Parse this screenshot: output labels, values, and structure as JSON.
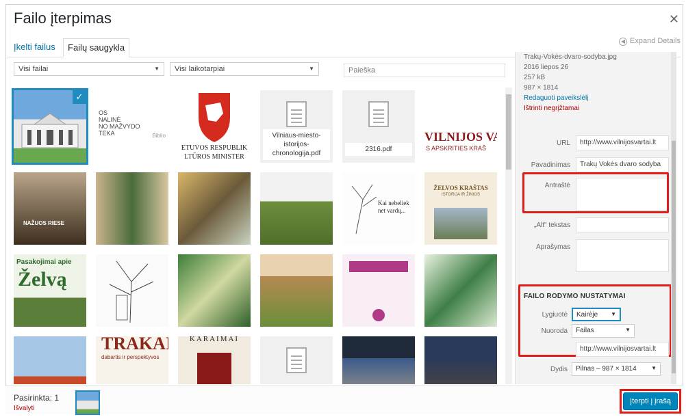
{
  "title": "Failo įterpimas",
  "tabs": {
    "upload": "Įkelti failus",
    "library": "Failų saugykla"
  },
  "expand_label": "Expand Details",
  "filters": {
    "type": "Visi failai",
    "date": "Visi laikotarpiai",
    "search_placeholder": "Paieška"
  },
  "grid": {
    "pdf1": "Vilniaus-miesto-istorijos-chronologija.pdf",
    "pdf2": "2316.pdf",
    "t_lib": "OS\nNALINĖ\nNO MAŽVYDO\nTEKA",
    "t_lib2": "Biblio",
    "t_culture": "ETUVOS RESPUBLIK\nLTŪROS MINISTER",
    "t_vilnijos": "VILNIJOS VA",
    "t_vilnijos2": "S APSKRITIES KRAŠ",
    "t_nazuiu": "NAŽUOS RIESE",
    "t_kai": "Kai nebeliek\nnet vardų...",
    "t_zelvos": "ŽELVOS KRAŠTAS",
    "t_zelvos2": "ISTORIJA IR ŽINIOS",
    "t_pasak": "Pasakojimai apie",
    "t_zelva": "Želvą",
    "t_trakai": "TRAKAI",
    "t_trakai2": "dabartis ir perspektyvos",
    "t_karaimai": "KARAIMAI"
  },
  "details": {
    "filename": "Trakų-Vokės-dvaro-sodyba.jpg",
    "date": "2016 liepos 26",
    "size": "257 kB",
    "dimensions": "987 × 1814",
    "edit_link": "Redaguoti paveikslėlį",
    "delete_link": "Ištrinti negrįžtamai"
  },
  "fields": {
    "url_label": "URL",
    "url_value": "http://www.vilnijosvartai.lt",
    "title_label": "Pavadinimas",
    "title_value": "Trakų Vokės dvaro sodyba",
    "caption_label": "Antraštė",
    "alt_label": "„Alt\" tekstas",
    "desc_label": "Aprašymas"
  },
  "display": {
    "section_title": "FAILO RODYMO NUSTATYMAI",
    "align_label": "Lygiuotė",
    "align_value": "Kairėje",
    "link_label": "Nuoroda",
    "link_value": "Failas",
    "link_url": "http://www.vilnijosvartai.lt",
    "size_label": "Dydis",
    "size_value": "Pilnas – 987 × 1814"
  },
  "footer": {
    "selected": "Pasirinkta: 1",
    "clear": "Išvalyti",
    "insert_button": "Įterpti į įrašą"
  },
  "colors": {
    "accent": "#1e8cbe",
    "primary_button": "#0085ba",
    "highlight_red": "#e21b1b"
  }
}
